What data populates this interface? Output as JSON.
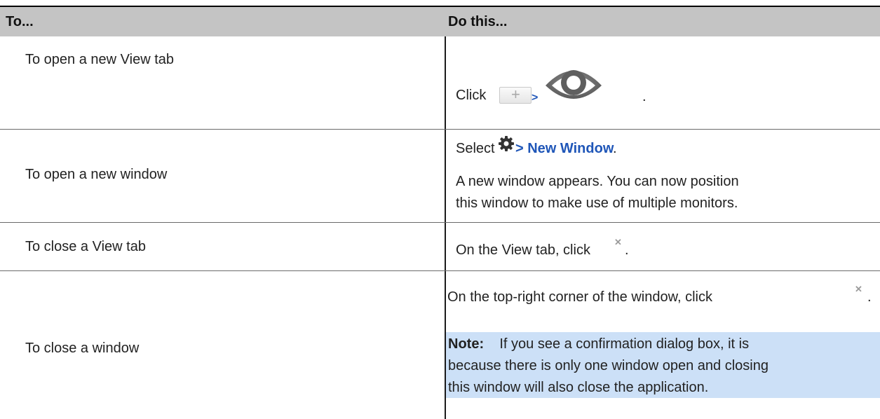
{
  "header": {
    "col1": "To...",
    "col2": "Do this..."
  },
  "rows": [
    {
      "task": "To open a new View tab",
      "click_label": "Click",
      "arrow": ">",
      "plus_icon": "plus-icon",
      "eye_icon": "eye-icon",
      "trailing": "."
    },
    {
      "task": "To open a new window",
      "select_label": "Select",
      "gear_icon": "gear-icon",
      "menu_path": "> New Window",
      "trailing": ".",
      "para_line1": "A new window appears. You can now position",
      "para_line2": "this window to make use of multiple monitors."
    },
    {
      "task": "To close a View tab",
      "instruction": "On the View tab, click",
      "close_icon": "close-icon",
      "trailing": "."
    },
    {
      "task": "To close a window",
      "instruction": "On the top-right corner of the window, click",
      "close_icon": "close-icon",
      "trailing": ".",
      "note_label": "Note:",
      "note_line1": "If you see a confirmation dialog box, it is",
      "note_line2": "because there is only one window open and closing",
      "note_line3": "this window will also close the application."
    }
  ],
  "colors": {
    "header_bg": "#c4c4c4",
    "link": "#1f56b8",
    "note_bg": "#cce0f7"
  }
}
